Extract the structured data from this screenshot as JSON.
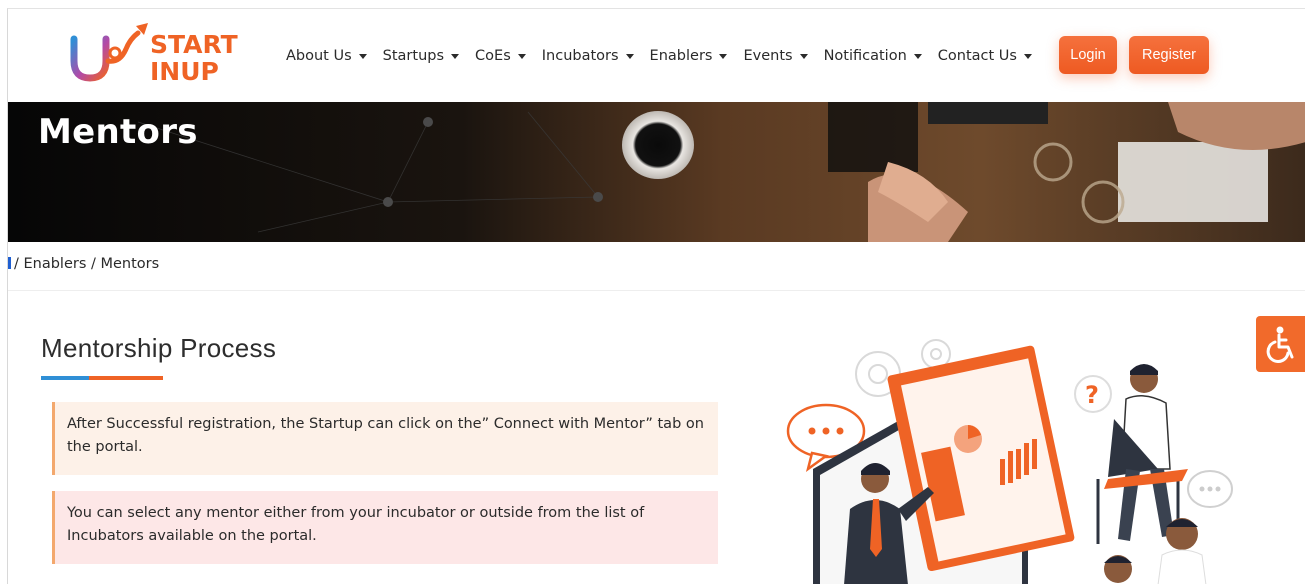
{
  "header": {
    "logo": {
      "line1": "START",
      "line2": "INUP"
    },
    "nav": [
      {
        "label": "About Us"
      },
      {
        "label": "Startups"
      },
      {
        "label": "CoEs"
      },
      {
        "label": "Incubators"
      },
      {
        "label": "Enablers"
      },
      {
        "label": "Events"
      },
      {
        "label": "Notification"
      },
      {
        "label": "Contact Us"
      }
    ],
    "login_label": "Login",
    "register_label": "Register"
  },
  "banner": {
    "title": "Mentors"
  },
  "breadcrumb": {
    "text": "/ Enablers / Mentors"
  },
  "content": {
    "section_title": "Mentorship Process",
    "cards": [
      {
        "text": "After Successful registration, the Startup can click on the” Connect with Mentor” tab on the portal."
      },
      {
        "text": "You can select any mentor either from your incubator or outside from the list of Incubators available on the portal."
      }
    ]
  },
  "colors": {
    "accent_orange": "#ef6325",
    "accent_blue": "#2f8fd6",
    "card1_bg": "#fdf1e8",
    "card2_bg": "#fde7e7"
  },
  "icons": {
    "accessibility": "wheelchair-icon",
    "dropdown": "caret-down-icon"
  }
}
